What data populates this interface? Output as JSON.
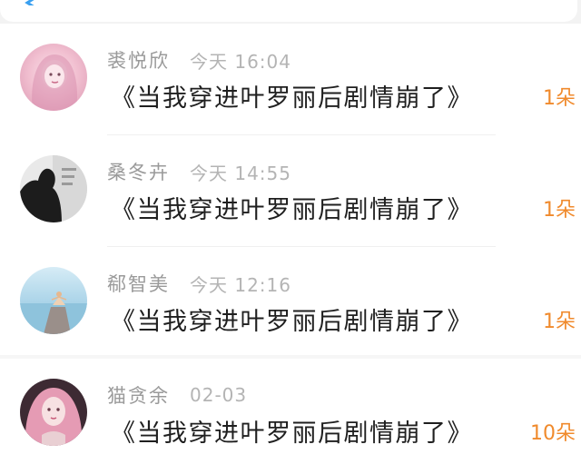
{
  "header": {
    "back_icon": "chevron-left-icon"
  },
  "messages": [
    {
      "name": "裘悦欣",
      "time": "今天 16:04",
      "title": "《当我穿进叶罗丽后剧情崩了》",
      "count": "1朵",
      "avatar": "pink-hair-girl-avatar"
    },
    {
      "name": "桑冬卉",
      "time": "今天 14:55",
      "title": "《当我穿进叶罗丽后剧情崩了》",
      "count": "1朵",
      "avatar": "dark-silhouette-avatar"
    },
    {
      "name": "郗智美",
      "time": "今天 12:16",
      "title": "《当我穿进叶罗丽后剧情崩了》",
      "count": "1朵",
      "avatar": "sea-meditation-avatar"
    },
    {
      "name": "猫贪余",
      "time": "02-03",
      "title": "《当我穿进叶罗丽后剧情崩了》",
      "count": "10朵",
      "avatar": "pink-hair-doll-avatar"
    }
  ],
  "colors": {
    "accent": "#f08a2c",
    "name": "#9a9a9a",
    "time": "#b4b4b4",
    "title": "#1f1f1f"
  }
}
